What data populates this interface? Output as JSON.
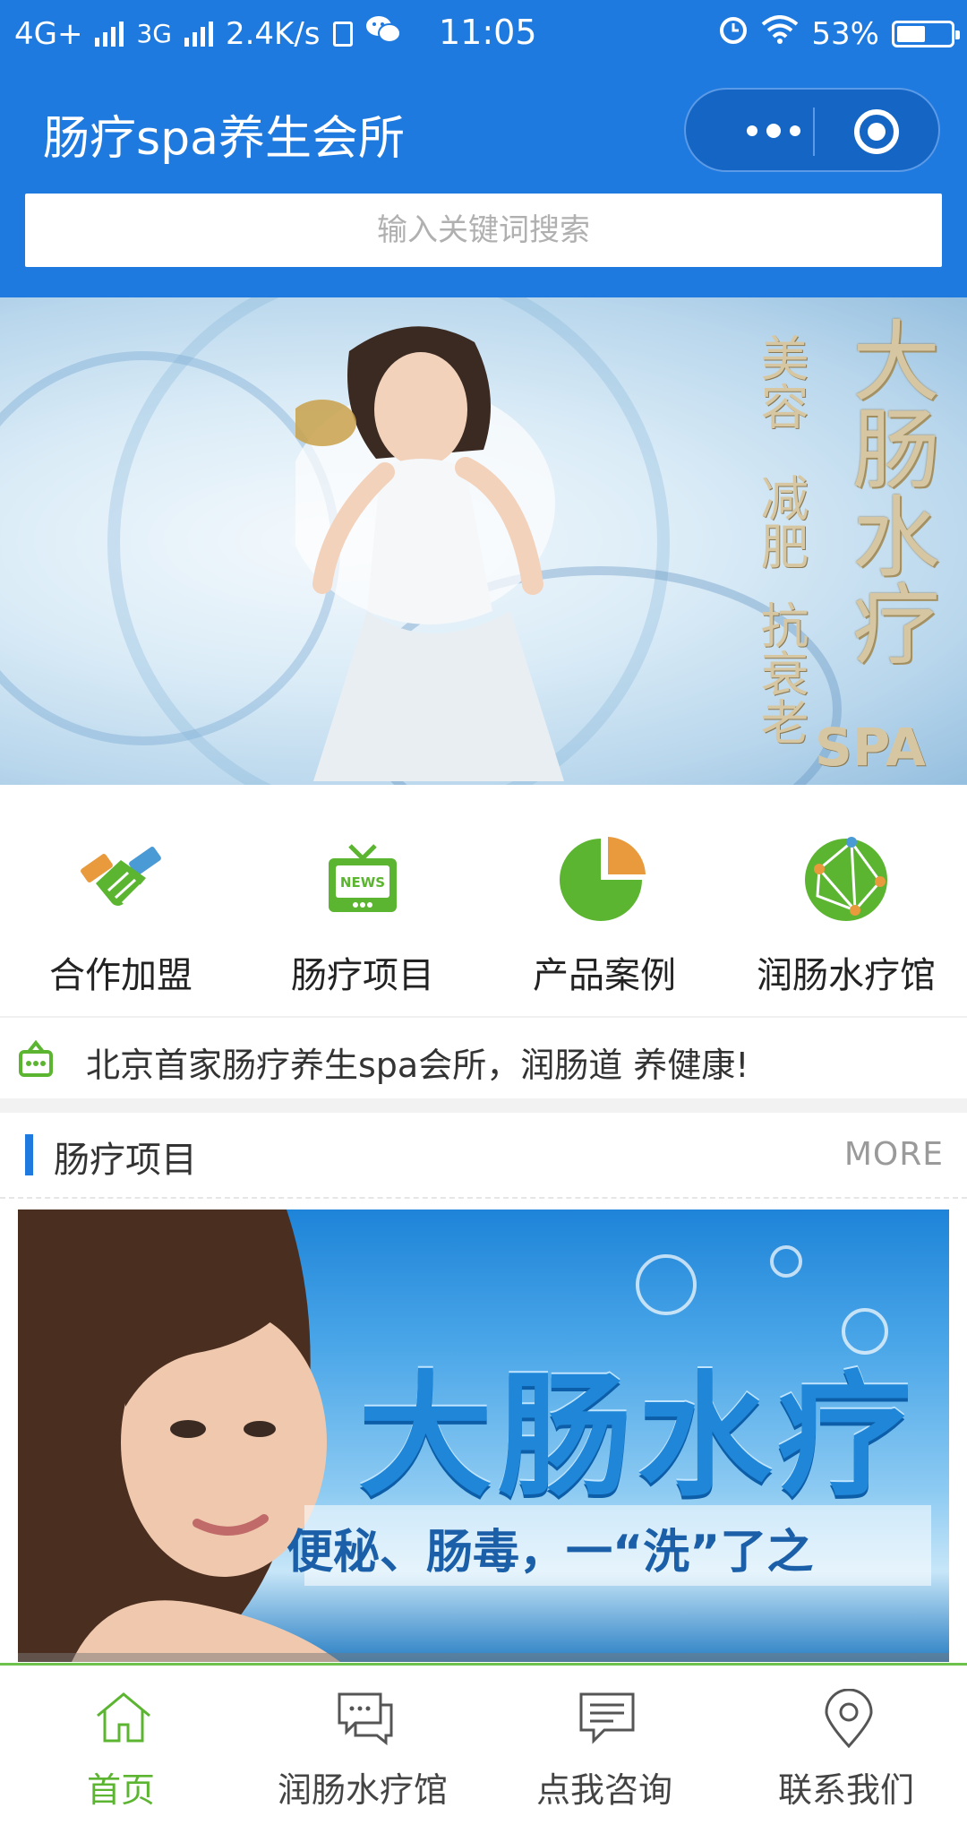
{
  "status_bar": {
    "network_left": "4G+",
    "network_mid": "3G",
    "speed": "2.4K/s",
    "time": "11:05",
    "battery": "53%",
    "battery_level": 0.53
  },
  "nav": {
    "title": "肠疗spa养生会所",
    "more_icon": "more-dots-icon",
    "close_icon": "target-icon"
  },
  "search": {
    "placeholder": "输入关键词搜索"
  },
  "banner": {
    "title": "大肠水疗",
    "sub_1": "美容",
    "sub_2": "减肥",
    "sub_3": "抗衰老",
    "brand": "SPA",
    "indicator_count": 4,
    "active_index": 1
  },
  "grid": [
    {
      "label": "合作加盟",
      "icon": "handshake-icon",
      "color": "#5cb531"
    },
    {
      "label": "肠疗项目",
      "icon": "news-tv-icon",
      "color": "#5cb531"
    },
    {
      "label": "产品案例",
      "icon": "pie-chart-icon",
      "color": "#5cb531"
    },
    {
      "label": "润肠水疗馆",
      "icon": "globe-network-icon",
      "color": "#5cb531"
    }
  ],
  "notice": {
    "icon": "megaphone-icon",
    "text": "北京首家肠疗养生spa会所，润肠道 养健康!"
  },
  "section": {
    "title": "肠疗项目",
    "more": "MORE"
  },
  "card": {
    "headline": "大肠水疗",
    "subline": "便秘、肠毒，一“洗”了之"
  },
  "tabbar": [
    {
      "label": "首页",
      "icon": "home-icon",
      "active": true
    },
    {
      "label": "润肠水疗馆",
      "icon": "chat-bubbles-icon",
      "active": false
    },
    {
      "label": "点我咨询",
      "icon": "message-icon",
      "active": false
    },
    {
      "label": "联系我们",
      "icon": "location-pin-icon",
      "active": false
    }
  ],
  "colors": {
    "primary_blue": "#1f7ae0",
    "accent_green": "#5cb531",
    "orange": "#e89a3c"
  }
}
